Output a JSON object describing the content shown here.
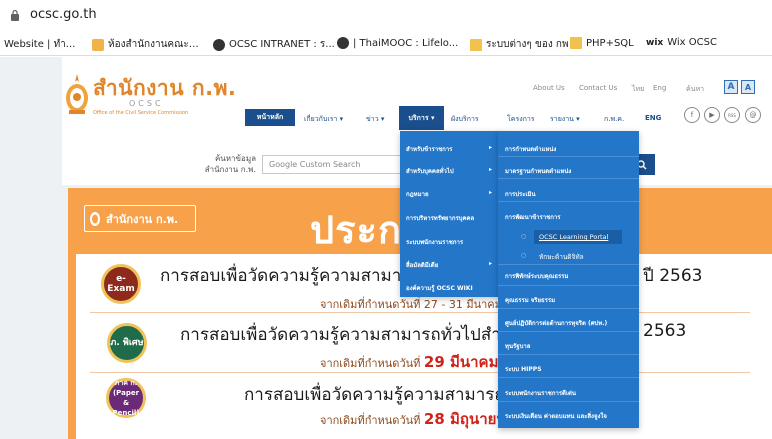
{
  "browser": {
    "url": "ocsc.go.th",
    "bookmarks": [
      {
        "label": "Website | ทำ...",
        "icon": "page-icon"
      },
      {
        "label": "ห้องสำนักงานคณะกรรมการข้าราชการพลเรือน",
        "icon": "emblem-icon"
      },
      {
        "label": "OCSC INTRANET : ร...",
        "icon": "globe-icon"
      },
      {
        "label": "| ThaiMOOC : Lifelo...",
        "icon": "globe-icon"
      },
      {
        "label": "ระบบต่างๆ ของ กพ",
        "icon": "folder-icon"
      },
      {
        "label": "PHP+SQL",
        "icon": "folder-icon"
      },
      {
        "label": "Wix OCSC",
        "icon": "wix-icon"
      }
    ]
  },
  "site": {
    "logo_text": "สำนักงาน ก.พ.",
    "logo_ocsc": "OCSC",
    "logo_sub": "Office of the Civil Service Commission",
    "top_links": [
      "About Us",
      "Contact Us",
      "ไทย",
      "Eng",
      "ค้นหา"
    ],
    "font_sizes": [
      "A",
      "A"
    ],
    "nav": {
      "home": "หน้าหลัก",
      "items": [
        "เกี่ยวกับเรา ▾",
        "ข่าว ▾",
        "บริการ ▾",
        "ผังบริการ",
        "โครงการ",
        "รายงาน ▾",
        "ก.พ.ค.",
        "ENG"
      ],
      "active": "บริการ ▾"
    },
    "social": [
      "f",
      "▶",
      "RSS",
      "@"
    ],
    "search": {
      "label": "ค้นหาข้อมูล สำนักงาน ก.พ.",
      "placeholder": "Google Custom Search"
    }
  },
  "menu": {
    "level1": [
      {
        "label": "สำหรับข้าราชการ",
        "arrow": true
      },
      {
        "label": "สำหรับบุคคลทั่วไป",
        "arrow": true
      },
      {
        "label": "กฎหมาย",
        "arrow": true
      },
      {
        "label": "การบริหารทรัพยากรบุคคล",
        "arrow": false
      },
      {
        "label": "ระบบพนักงานราชการ",
        "arrow": false
      },
      {
        "label": "สื่อมัลติมีเดีย",
        "arrow": true
      },
      {
        "label": "องค์ความรู้ OCSC WIKI",
        "arrow": false
      }
    ],
    "level2": [
      "การกำหนดตำแหน่ง",
      "มาตรฐานกำหนดตำแหน่ง",
      "การประเมิน",
      "การพัฒนาข้าราชการ",
      "",
      "",
      "การพิทักษ์ระบบคุณธรรม",
      "คุณธรรม จริยธรรม",
      "ศูนย์ปฏิบัติการต่อต้านการทุจริต (ศปท.)",
      "ทุนรัฐบาล",
      "ระบบ HIPPS",
      "ระบบพนักงานราชการดีเด่น",
      "ระบบเงินเดือน ค่าตอบแทน และสิ่งจูงใจ"
    ],
    "level3": [
      "OCSC Learning Portal",
      "ทักษะด้านดิจิทัล"
    ]
  },
  "banner": {
    "logo_text": "สำนักงาน ก.พ.",
    "title": "ประกาศ",
    "rows": [
      {
        "badge": "e-Exam",
        "badge_color": "#8e2a1c",
        "title": "การสอบเพื่อวัดความรู้ความสามารถ",
        "title_tail": "ปี 2563",
        "sub": "จากเดิมที่กำหนดวันที่ 27 - 31 มีนาคม",
        "sub_red": ""
      },
      {
        "badge": "ภ. พิเศษ",
        "badge_color": "#1f6b4a",
        "title": "การสอบเพื่อวัดความรู้ความสามารถทั่วไปสำหรับ",
        "title_tail": "2563",
        "sub": "จากเดิมที่กำหนดวันที่",
        "sub_red": "29 มีนาคม"
      },
      {
        "badge": "ภาค ก. (Paper & Pencil)",
        "badge_color": "#6b2a78",
        "title": "การสอบเพื่อวัดความรู้ความสามารถทั่ว",
        "title_tail": "",
        "sub": "จากเดิมที่กำหนดวันที่",
        "sub_red": "28 มิถุนายน"
      }
    ]
  },
  "colors": {
    "orange": "#f7a24b",
    "navy": "#1a4e8c",
    "menu_blue": "#2476c8"
  }
}
